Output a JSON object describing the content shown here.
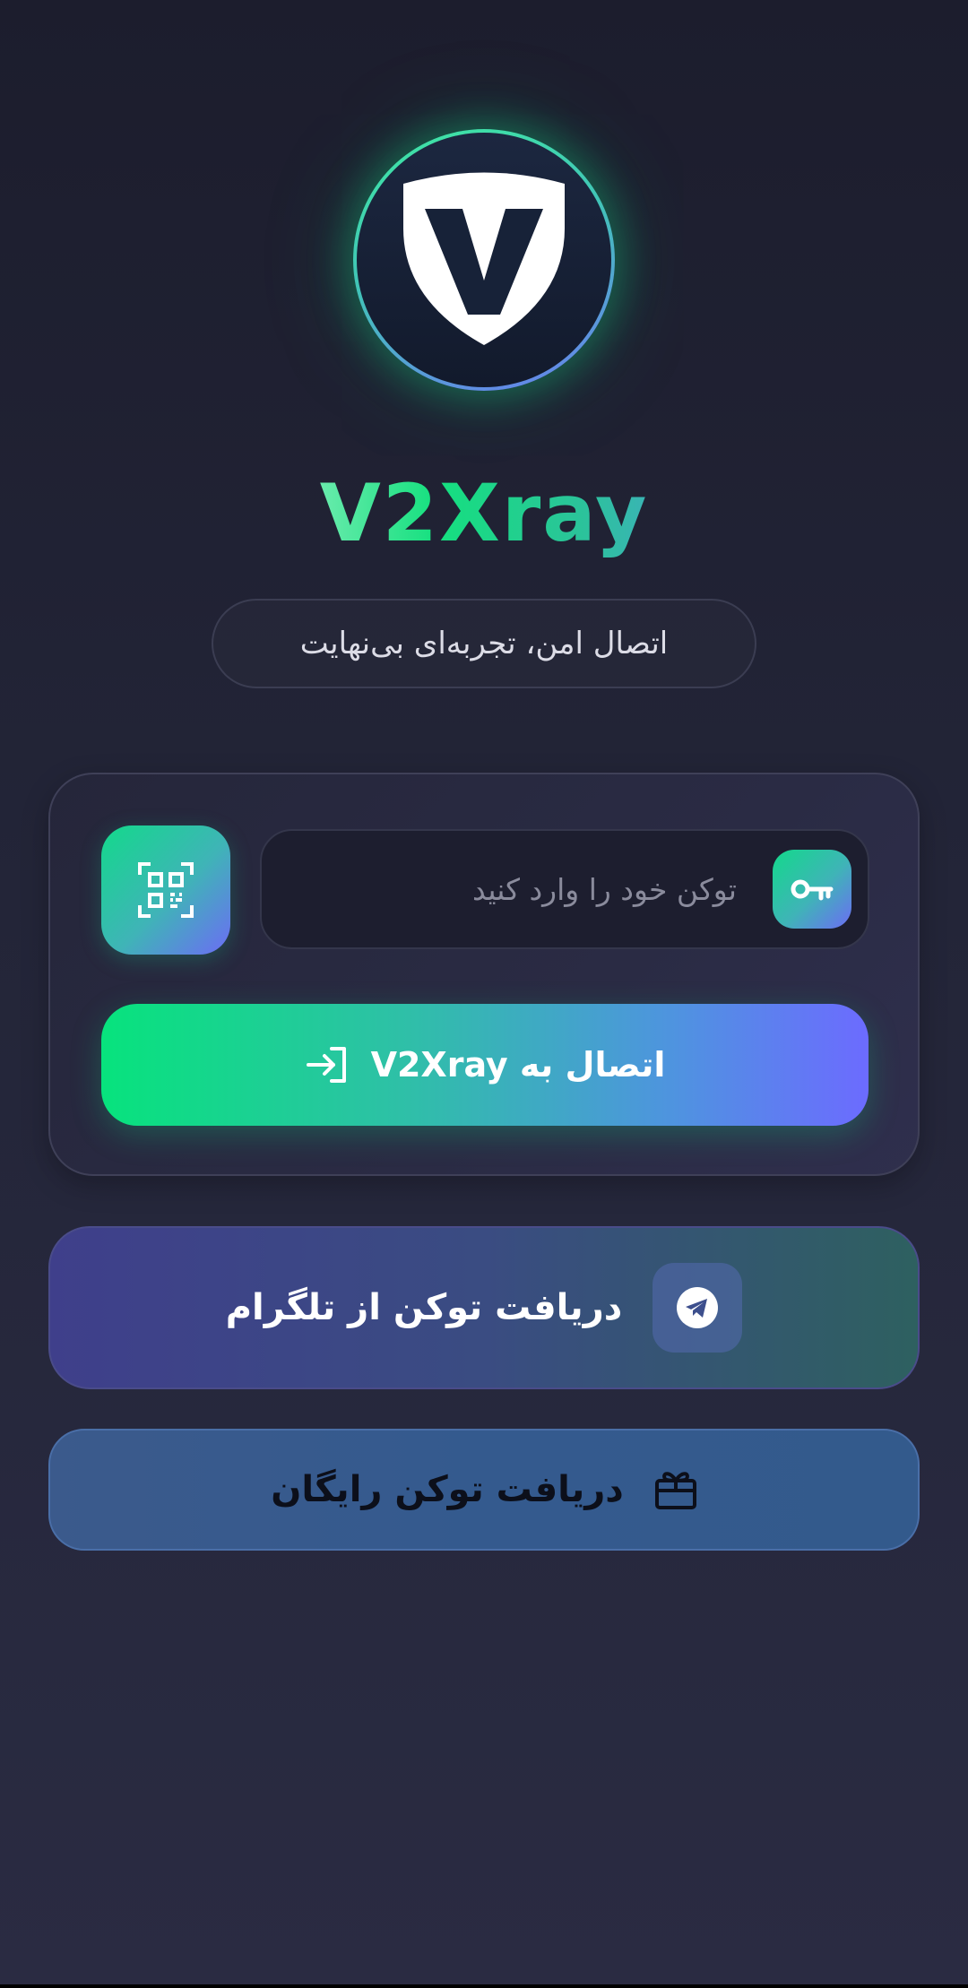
{
  "app": {
    "title": "V2Xray",
    "tagline": "اتصال امن، تجربه‌ای بی‌نهایت"
  },
  "login_card": {
    "token_input": {
      "value": "",
      "placeholder": "توکن خود را وارد کنید"
    },
    "connect_button_label": "اتصال به V2Xray"
  },
  "telegram_button_label": "دریافت توکن از تلگرام",
  "free_token_button_label": "دریافت توکن رایگان",
  "icons": {
    "logo": "shield-v-logo",
    "qr": "qr-scan-icon",
    "key": "key-icon",
    "connect": "login-arrow-icon",
    "telegram": "telegram-icon",
    "gift": "gift-icon"
  },
  "colors": {
    "accent_green": "#07e37d",
    "accent_violet": "#6c6bff",
    "background": "#232538"
  }
}
